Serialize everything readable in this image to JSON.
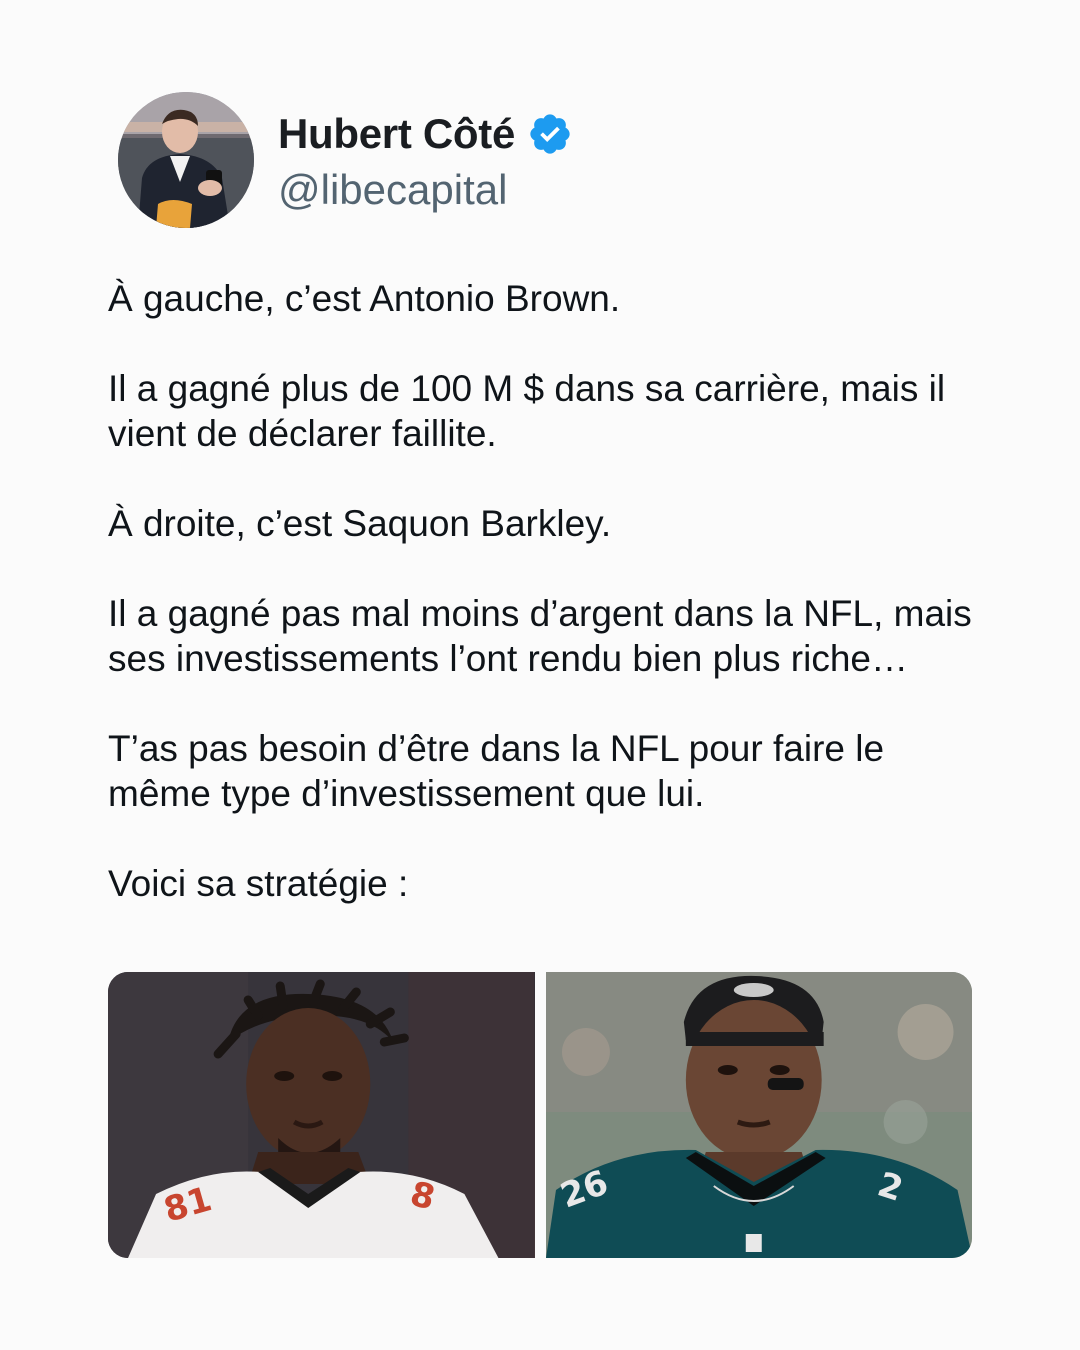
{
  "author": {
    "name": "Hubert Côté",
    "handle": "@libecapital",
    "verified": true
  },
  "tweet": {
    "paragraphs": [
      "À gauche, c’est Antonio Brown.",
      "Il a gagné plus de 100 M $ dans sa carrière, mais il vient de déclarer faillite.",
      "À droite, c’est Saquon Barkley.",
      "Il a gagné pas mal moins d’argent dans la NFL, mais ses investissements l’ont rendu bien plus riche…",
      "T’as pas besoin d’être dans la NFL pour faire le même type d’investissement que lui.",
      "Voici sa stratégie :"
    ]
  },
  "media": {
    "left_jersey_number": "81",
    "right_jersey_number": "26"
  },
  "colors": {
    "background": "#fbfbfb",
    "verified_blue": "#1d9bf0",
    "text_primary": "#0f1419",
    "text_secondary": "#536471"
  }
}
